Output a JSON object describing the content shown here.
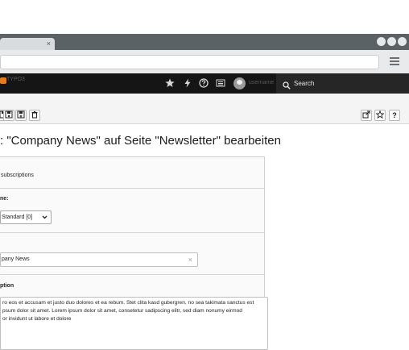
{
  "browser": {
    "tab_close": "×"
  },
  "topbar": {
    "brand": "TYPO3",
    "user": "username",
    "search_label": "Search"
  },
  "page": {
    "title": ": \"Company News\" auf Seite \"Newsletter\" bearbeiten"
  },
  "form": {
    "type_value": "subscriptions",
    "layout_label": "ne:",
    "layout_value": "Standard [0]",
    "title_value": "pany News",
    "clear_glyph": "×",
    "description_label": "ption",
    "description_lines": [
      "ro eos et accusam et justo duo dolores et ea rebum. Stet clita kasd gubergren, no sea takimata sanctus est",
      "psum dolor sit amet. Lorem ipsum dolor sit amet, consetetur sadipscing elitr, sed diam nonumy eirmod",
      "or invidunt ut labore et dolore"
    ]
  },
  "icons": {
    "star": "star-icon",
    "flash": "flash-icon",
    "help": "help-icon",
    "list": "list-icon",
    "open": "open-external-icon",
    "bookmark": "bookmark-icon",
    "question": "question-icon"
  }
}
